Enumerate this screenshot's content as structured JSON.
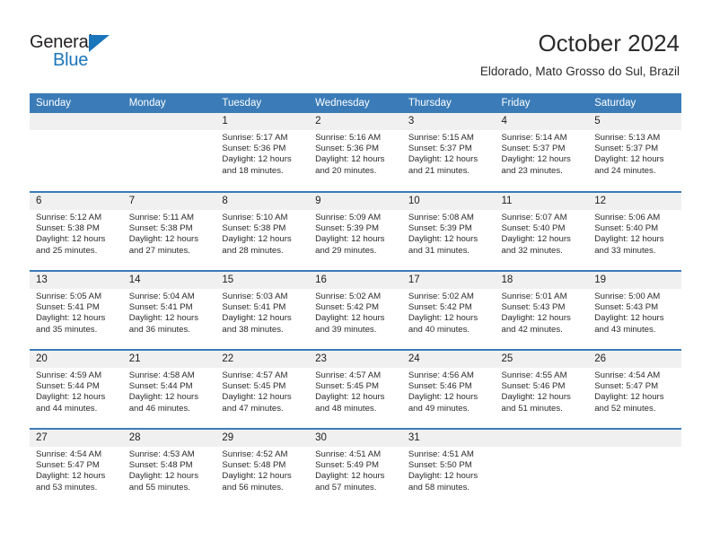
{
  "brand": {
    "word_one": "General",
    "word_two": "Blue",
    "triangle_color": "#1b75bb"
  },
  "header": {
    "title": "October 2024",
    "subtitle": "Eldorado, Mato Grosso do Sul, Brazil",
    "header_bg": "#3b7cb8",
    "day_band_bg": "#f0f0f0"
  },
  "calendar": {
    "weekday_headers": [
      "Sunday",
      "Monday",
      "Tuesday",
      "Wednesday",
      "Thursday",
      "Friday",
      "Saturday"
    ],
    "weeks": [
      [
        {
          "day": "",
          "empty": true
        },
        {
          "day": "",
          "empty": true
        },
        {
          "day": "1",
          "sunrise": "Sunrise: 5:17 AM",
          "sunset": "Sunset: 5:36 PM",
          "daylight_1": "Daylight: 12 hours",
          "daylight_2": "and 18 minutes."
        },
        {
          "day": "2",
          "sunrise": "Sunrise: 5:16 AM",
          "sunset": "Sunset: 5:36 PM",
          "daylight_1": "Daylight: 12 hours",
          "daylight_2": "and 20 minutes."
        },
        {
          "day": "3",
          "sunrise": "Sunrise: 5:15 AM",
          "sunset": "Sunset: 5:37 PM",
          "daylight_1": "Daylight: 12 hours",
          "daylight_2": "and 21 minutes."
        },
        {
          "day": "4",
          "sunrise": "Sunrise: 5:14 AM",
          "sunset": "Sunset: 5:37 PM",
          "daylight_1": "Daylight: 12 hours",
          "daylight_2": "and 23 minutes."
        },
        {
          "day": "5",
          "sunrise": "Sunrise: 5:13 AM",
          "sunset": "Sunset: 5:37 PM",
          "daylight_1": "Daylight: 12 hours",
          "daylight_2": "and 24 minutes."
        }
      ],
      [
        {
          "day": "6",
          "sunrise": "Sunrise: 5:12 AM",
          "sunset": "Sunset: 5:38 PM",
          "daylight_1": "Daylight: 12 hours",
          "daylight_2": "and 25 minutes."
        },
        {
          "day": "7",
          "sunrise": "Sunrise: 5:11 AM",
          "sunset": "Sunset: 5:38 PM",
          "daylight_1": "Daylight: 12 hours",
          "daylight_2": "and 27 minutes."
        },
        {
          "day": "8",
          "sunrise": "Sunrise: 5:10 AM",
          "sunset": "Sunset: 5:38 PM",
          "daylight_1": "Daylight: 12 hours",
          "daylight_2": "and 28 minutes."
        },
        {
          "day": "9",
          "sunrise": "Sunrise: 5:09 AM",
          "sunset": "Sunset: 5:39 PM",
          "daylight_1": "Daylight: 12 hours",
          "daylight_2": "and 29 minutes."
        },
        {
          "day": "10",
          "sunrise": "Sunrise: 5:08 AM",
          "sunset": "Sunset: 5:39 PM",
          "daylight_1": "Daylight: 12 hours",
          "daylight_2": "and 31 minutes."
        },
        {
          "day": "11",
          "sunrise": "Sunrise: 5:07 AM",
          "sunset": "Sunset: 5:40 PM",
          "daylight_1": "Daylight: 12 hours",
          "daylight_2": "and 32 minutes."
        },
        {
          "day": "12",
          "sunrise": "Sunrise: 5:06 AM",
          "sunset": "Sunset: 5:40 PM",
          "daylight_1": "Daylight: 12 hours",
          "daylight_2": "and 33 minutes."
        }
      ],
      [
        {
          "day": "13",
          "sunrise": "Sunrise: 5:05 AM",
          "sunset": "Sunset: 5:41 PM",
          "daylight_1": "Daylight: 12 hours",
          "daylight_2": "and 35 minutes."
        },
        {
          "day": "14",
          "sunrise": "Sunrise: 5:04 AM",
          "sunset": "Sunset: 5:41 PM",
          "daylight_1": "Daylight: 12 hours",
          "daylight_2": "and 36 minutes."
        },
        {
          "day": "15",
          "sunrise": "Sunrise: 5:03 AM",
          "sunset": "Sunset: 5:41 PM",
          "daylight_1": "Daylight: 12 hours",
          "daylight_2": "and 38 minutes."
        },
        {
          "day": "16",
          "sunrise": "Sunrise: 5:02 AM",
          "sunset": "Sunset: 5:42 PM",
          "daylight_1": "Daylight: 12 hours",
          "daylight_2": "and 39 minutes."
        },
        {
          "day": "17",
          "sunrise": "Sunrise: 5:02 AM",
          "sunset": "Sunset: 5:42 PM",
          "daylight_1": "Daylight: 12 hours",
          "daylight_2": "and 40 minutes."
        },
        {
          "day": "18",
          "sunrise": "Sunrise: 5:01 AM",
          "sunset": "Sunset: 5:43 PM",
          "daylight_1": "Daylight: 12 hours",
          "daylight_2": "and 42 minutes."
        },
        {
          "day": "19",
          "sunrise": "Sunrise: 5:00 AM",
          "sunset": "Sunset: 5:43 PM",
          "daylight_1": "Daylight: 12 hours",
          "daylight_2": "and 43 minutes."
        }
      ],
      [
        {
          "day": "20",
          "sunrise": "Sunrise: 4:59 AM",
          "sunset": "Sunset: 5:44 PM",
          "daylight_1": "Daylight: 12 hours",
          "daylight_2": "and 44 minutes."
        },
        {
          "day": "21",
          "sunrise": "Sunrise: 4:58 AM",
          "sunset": "Sunset: 5:44 PM",
          "daylight_1": "Daylight: 12 hours",
          "daylight_2": "and 46 minutes."
        },
        {
          "day": "22",
          "sunrise": "Sunrise: 4:57 AM",
          "sunset": "Sunset: 5:45 PM",
          "daylight_1": "Daylight: 12 hours",
          "daylight_2": "and 47 minutes."
        },
        {
          "day": "23",
          "sunrise": "Sunrise: 4:57 AM",
          "sunset": "Sunset: 5:45 PM",
          "daylight_1": "Daylight: 12 hours",
          "daylight_2": "and 48 minutes."
        },
        {
          "day": "24",
          "sunrise": "Sunrise: 4:56 AM",
          "sunset": "Sunset: 5:46 PM",
          "daylight_1": "Daylight: 12 hours",
          "daylight_2": "and 49 minutes."
        },
        {
          "day": "25",
          "sunrise": "Sunrise: 4:55 AM",
          "sunset": "Sunset: 5:46 PM",
          "daylight_1": "Daylight: 12 hours",
          "daylight_2": "and 51 minutes."
        },
        {
          "day": "26",
          "sunrise": "Sunrise: 4:54 AM",
          "sunset": "Sunset: 5:47 PM",
          "daylight_1": "Daylight: 12 hours",
          "daylight_2": "and 52 minutes."
        }
      ],
      [
        {
          "day": "27",
          "sunrise": "Sunrise: 4:54 AM",
          "sunset": "Sunset: 5:47 PM",
          "daylight_1": "Daylight: 12 hours",
          "daylight_2": "and 53 minutes."
        },
        {
          "day": "28",
          "sunrise": "Sunrise: 4:53 AM",
          "sunset": "Sunset: 5:48 PM",
          "daylight_1": "Daylight: 12 hours",
          "daylight_2": "and 55 minutes."
        },
        {
          "day": "29",
          "sunrise": "Sunrise: 4:52 AM",
          "sunset": "Sunset: 5:48 PM",
          "daylight_1": "Daylight: 12 hours",
          "daylight_2": "and 56 minutes."
        },
        {
          "day": "30",
          "sunrise": "Sunrise: 4:51 AM",
          "sunset": "Sunset: 5:49 PM",
          "daylight_1": "Daylight: 12 hours",
          "daylight_2": "and 57 minutes."
        },
        {
          "day": "31",
          "sunrise": "Sunrise: 4:51 AM",
          "sunset": "Sunset: 5:50 PM",
          "daylight_1": "Daylight: 12 hours",
          "daylight_2": "and 58 minutes."
        },
        {
          "day": "",
          "empty": true
        },
        {
          "day": "",
          "empty": true
        }
      ]
    ]
  }
}
